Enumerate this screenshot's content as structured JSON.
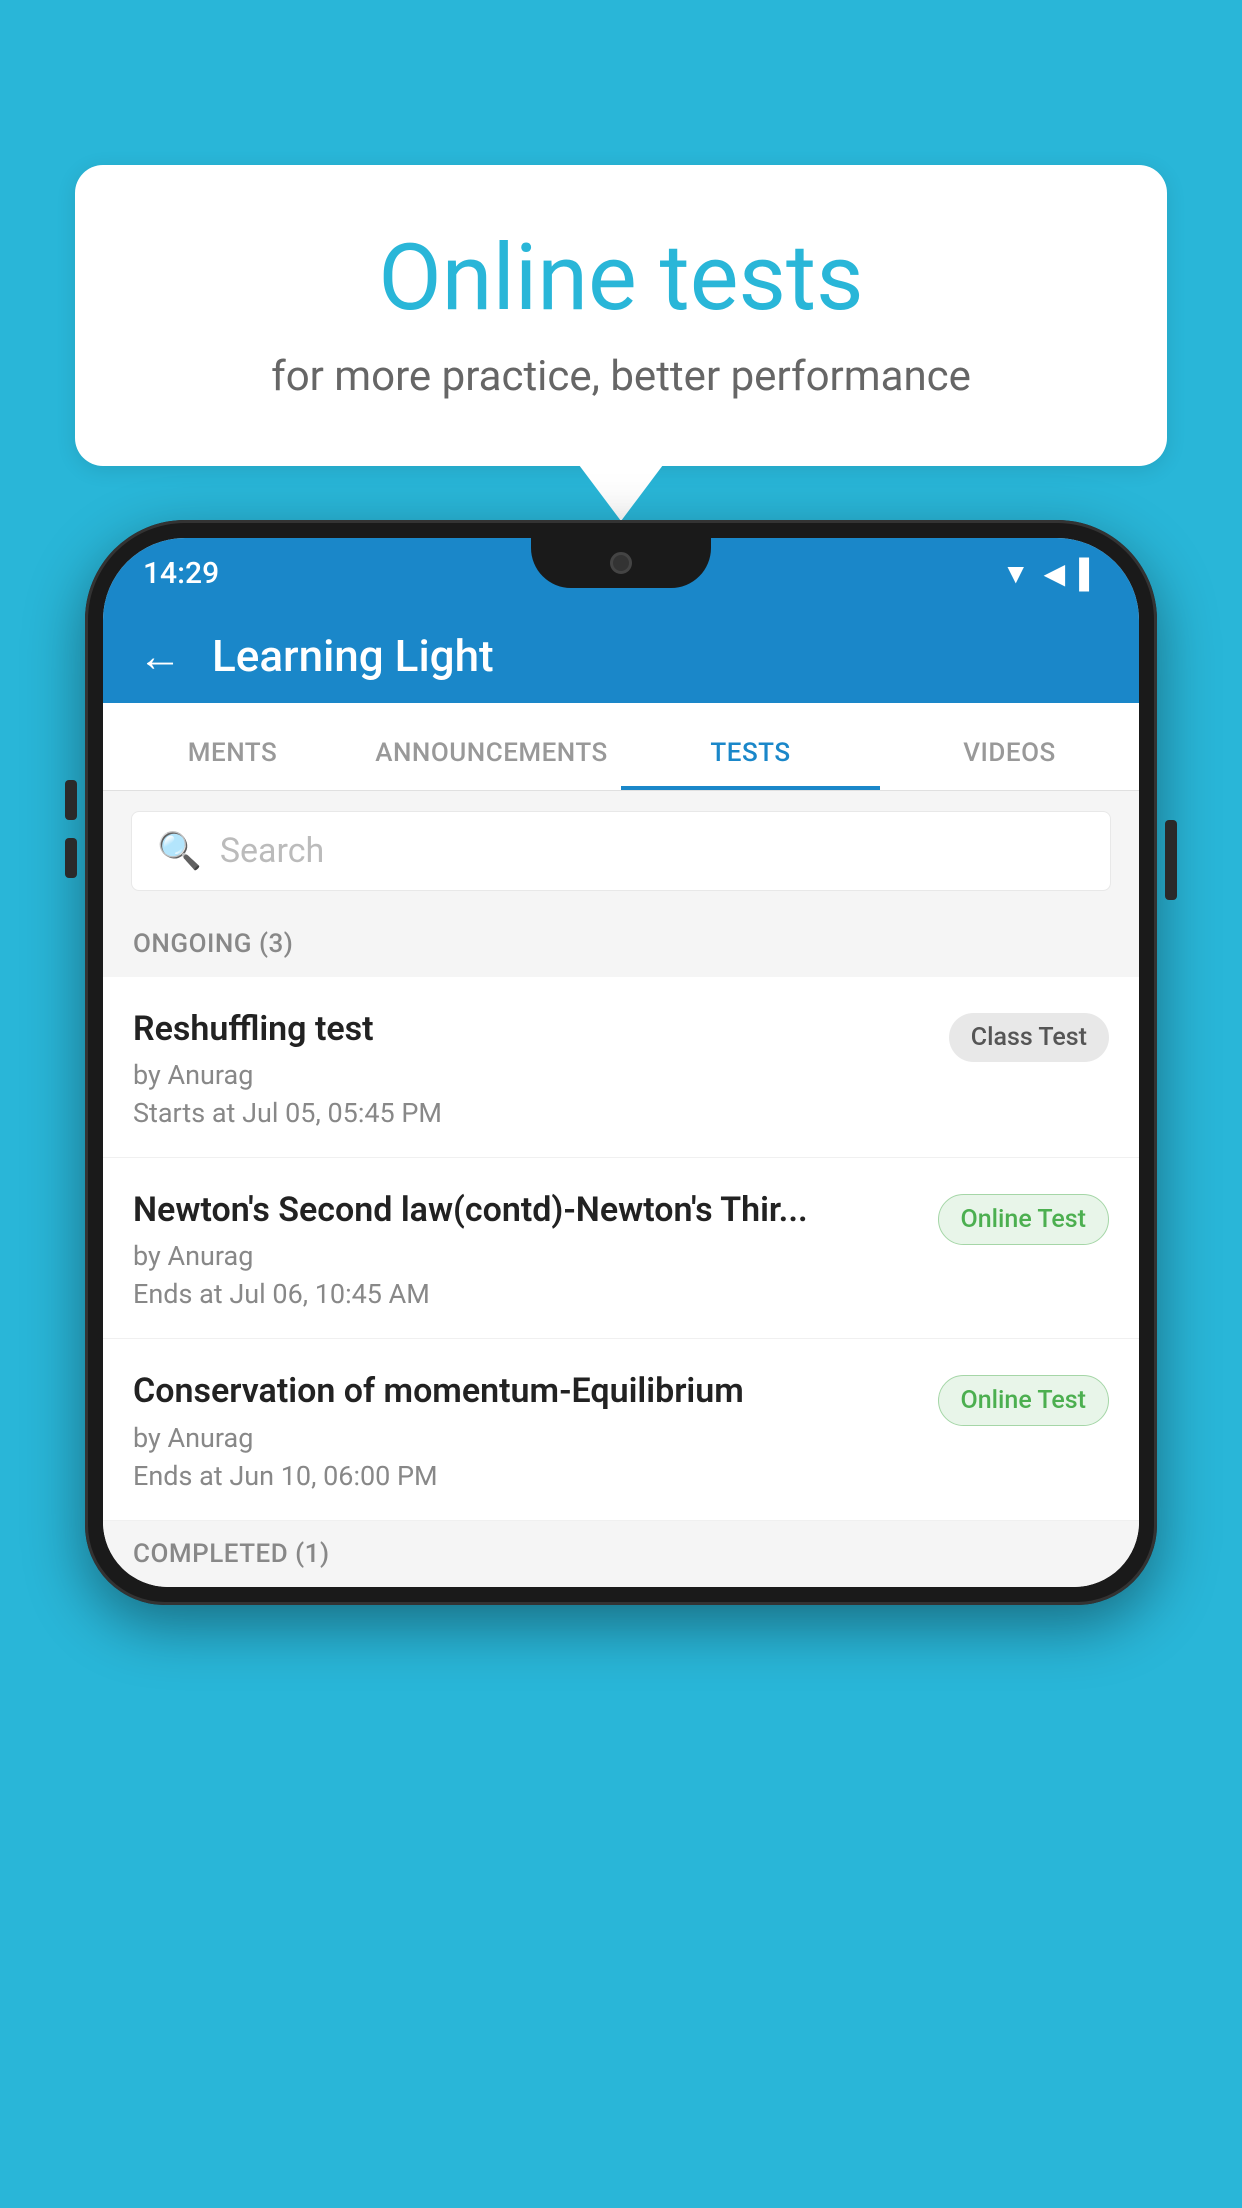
{
  "background_color": "#29b6d8",
  "bubble": {
    "title": "Online tests",
    "subtitle": "for more practice, better performance"
  },
  "phone": {
    "status_bar": {
      "time": "14:29",
      "icons": [
        "▼",
        "◀",
        "▌"
      ]
    },
    "app_header": {
      "title": "Learning Light",
      "back_label": "←"
    },
    "tabs": [
      {
        "label": "MENTS",
        "active": false
      },
      {
        "label": "ANNOUNCEMENTS",
        "active": false
      },
      {
        "label": "TESTS",
        "active": true
      },
      {
        "label": "VIDEOS",
        "active": false
      }
    ],
    "search": {
      "placeholder": "Search",
      "icon": "🔍"
    },
    "ongoing_section": {
      "label": "ONGOING (3)",
      "items": [
        {
          "name": "Reshuffling test",
          "author": "by Anurag",
          "time_label": "Starts at",
          "time": "Jul 05, 05:45 PM",
          "badge": "Class Test",
          "badge_type": "class"
        },
        {
          "name": "Newton's Second law(contd)-Newton's Thir...",
          "author": "by Anurag",
          "time_label": "Ends at",
          "time": "Jul 06, 10:45 AM",
          "badge": "Online Test",
          "badge_type": "online"
        },
        {
          "name": "Conservation of momentum-Equilibrium",
          "author": "by Anurag",
          "time_label": "Ends at",
          "time": "Jun 10, 06:00 PM",
          "badge": "Online Test",
          "badge_type": "online"
        }
      ]
    },
    "completed_section": {
      "label": "COMPLETED (1)"
    }
  }
}
